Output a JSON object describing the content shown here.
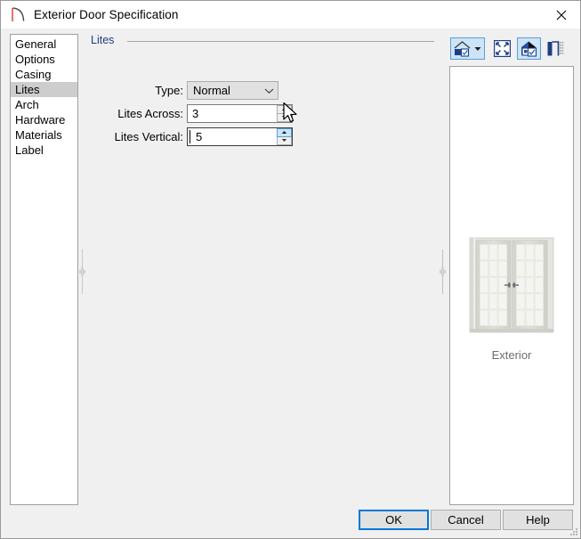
{
  "window": {
    "title": "Exterior Door Specification",
    "title_icon": "door-swing-icon",
    "close_icon": "close-icon"
  },
  "sidebar": {
    "name": "category-list",
    "items": [
      {
        "label": "General",
        "selected": false
      },
      {
        "label": "Options",
        "selected": false
      },
      {
        "label": "Casing",
        "selected": false
      },
      {
        "label": "Lites",
        "selected": true
      },
      {
        "label": "Arch",
        "selected": false
      },
      {
        "label": "Hardware",
        "selected": false
      },
      {
        "label": "Materials",
        "selected": false
      },
      {
        "label": "Label",
        "selected": false
      }
    ]
  },
  "group": {
    "label": "Lites",
    "label_color": "#1d3f7a"
  },
  "form": {
    "type": {
      "label": "Type:",
      "value": "Normal",
      "options": [
        "Normal"
      ],
      "arrow_icon": "chevron-down-icon"
    },
    "lites_across": {
      "label": "Lites Across:",
      "value": "3",
      "spinner_up_icon": "spin-up-arrow-icon",
      "spinner_down_icon": "spin-down-arrow-icon"
    },
    "lites_vertical": {
      "label": "Lites Vertical:",
      "value": "5",
      "focused": true,
      "spinner_up_icon": "spin-up-arrow-icon",
      "spinner_down_icon": "spin-down-arrow-icon"
    }
  },
  "preview": {
    "toolbar": [
      {
        "icon": "house-view-icon",
        "name": "preview-view-button",
        "active": true,
        "has_dropdown": true
      },
      {
        "icon": "dropdown-arrow-icon",
        "name": "preview-view-dropdown",
        "active": true
      },
      {
        "icon": "fill-window-icon",
        "name": "fill-window-button",
        "active": false
      },
      {
        "icon": "color-on-off-icon",
        "name": "color-toggle-button",
        "active": true
      },
      {
        "icon": "glass-house-icon",
        "name": "glass-house-button",
        "active": false
      }
    ],
    "caption": "Exterior",
    "caption_color": "#6d6d6d",
    "door": {
      "name": "double-french-door-preview",
      "panels": 2,
      "lites_across_per_panel": 3,
      "lites_vertical_per_panel": 5,
      "frame_color": "#dcdcd6",
      "glass_color": "#f2f2ee",
      "mullion_color": "#e7e7e1"
    }
  },
  "footer": {
    "ok": "OK",
    "cancel": "Cancel",
    "help": "Help",
    "accent_color": "#0078d7"
  },
  "splitters": {
    "left_name": "left-splitter-handle",
    "right_name": "right-splitter-handle"
  },
  "cursor": {
    "icon": "mouse-pointer-icon"
  }
}
